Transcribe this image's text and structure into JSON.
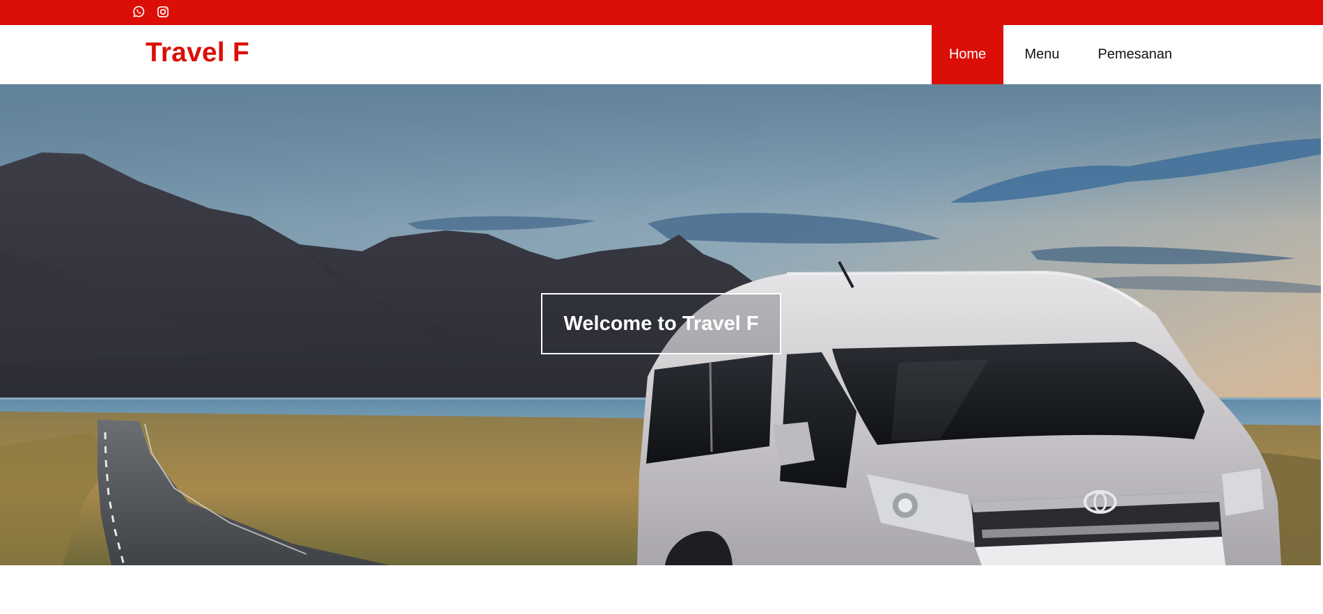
{
  "topbar": {
    "background": "#db0f07",
    "icons": [
      {
        "name": "whatsapp-icon"
      },
      {
        "name": "instagram-icon"
      }
    ]
  },
  "header": {
    "brand": "Travel F",
    "brand_color": "#db0f07",
    "nav": [
      {
        "label": "Home",
        "active": true
      },
      {
        "label": "Menu",
        "active": false
      },
      {
        "label": "Pemesanan",
        "active": false
      }
    ]
  },
  "hero": {
    "welcome_text": "Welcome to Travel F",
    "image_subject": "silver minivan on coastal road with mountains at sunset"
  }
}
